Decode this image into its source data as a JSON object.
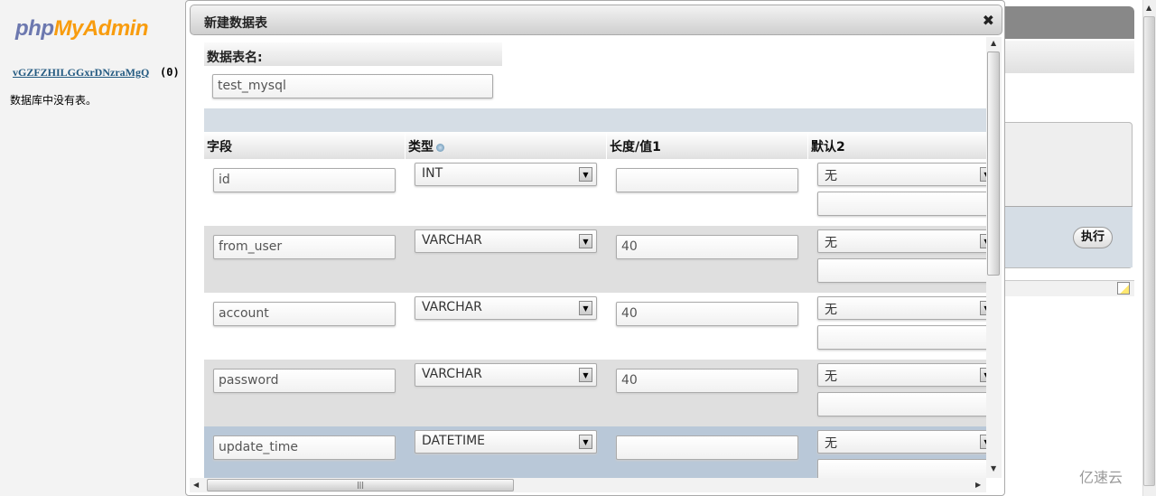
{
  "nav": {
    "logo_php": "php",
    "logo_myadmin": "MyAdmin",
    "db_link": "vGZFZHILGGxrDNzraMgQ",
    "db_count": "(0)",
    "no_tables": "数据库中没有表。"
  },
  "background": {
    "execute_label": "执行"
  },
  "dialog": {
    "title": "新建数据表",
    "close_icon": "close-icon",
    "table_name_label": "数据表名:",
    "table_name_value": "test_mysql",
    "columns": [
      {
        "label": "字段"
      },
      {
        "label": "类型",
        "icon": "help-icon"
      },
      {
        "label": "长度/值1"
      },
      {
        "label": "默认2"
      }
    ],
    "rows": [
      {
        "name": "id",
        "type": "INT",
        "length": "",
        "default": "无",
        "default_value": ""
      },
      {
        "name": "from_user",
        "type": "VARCHAR",
        "length": "40",
        "default": "无",
        "default_value": ""
      },
      {
        "name": "account",
        "type": "VARCHAR",
        "length": "40",
        "default": "无",
        "default_value": ""
      },
      {
        "name": "password",
        "type": "VARCHAR",
        "length": "40",
        "default": "无",
        "default_value": ""
      },
      {
        "name": "update_time",
        "type": "DATETIME",
        "length": "",
        "default": "无",
        "default_value": ""
      }
    ]
  },
  "watermark": "亿速云"
}
